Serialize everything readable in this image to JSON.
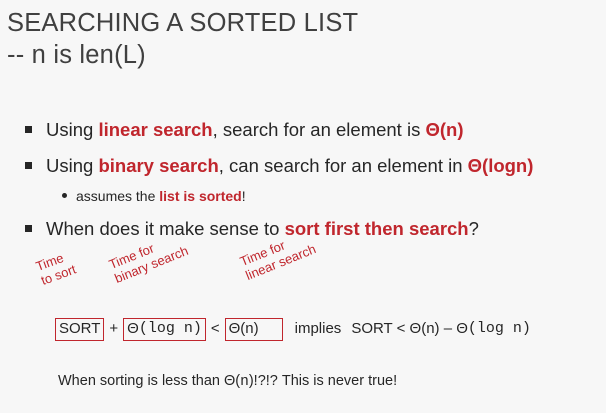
{
  "title": {
    "line1": "SEARCHING A SORTED LIST",
    "line2": "-- n is len(L)"
  },
  "bullet1": {
    "pre": "Using ",
    "em": "linear search",
    "mid": ", search for an element is ",
    "em2": "Θ(n)"
  },
  "bullet2": {
    "pre": "Using ",
    "em": "binary search",
    "mid": ", can search for an element in ",
    "em2": "Θ(logn)"
  },
  "sub": {
    "pre": "assumes the ",
    "em": "list is sorted",
    "post": "!"
  },
  "bullet3": {
    "pre": "When does it make sense to ",
    "em": "sort first then search",
    "post": "?"
  },
  "notes": {
    "sort_l1": "Time",
    "sort_l2": "to sort",
    "binary_l1": "Time for",
    "binary_l2": "binary search",
    "linear_l1": "Time for",
    "linear_l2": "linear  search"
  },
  "equation": {
    "sort": "SORT",
    "plus": "+",
    "theta": "Θ",
    "log_n": "(log n)",
    "lt": "<",
    "theta_n": "Θ(n)",
    "implies": "implies",
    "rhs_pre": "SORT < Θ(n) – Θ",
    "rhs_log": "(log n)"
  },
  "footer": {
    "pre": "When sorting is less than Θ(",
    "n": "n",
    "post": ")!?!? This is never true!"
  },
  "colors": {
    "accent_red": "#c0262d",
    "text": "#262626",
    "background": "#f7f7f7"
  }
}
